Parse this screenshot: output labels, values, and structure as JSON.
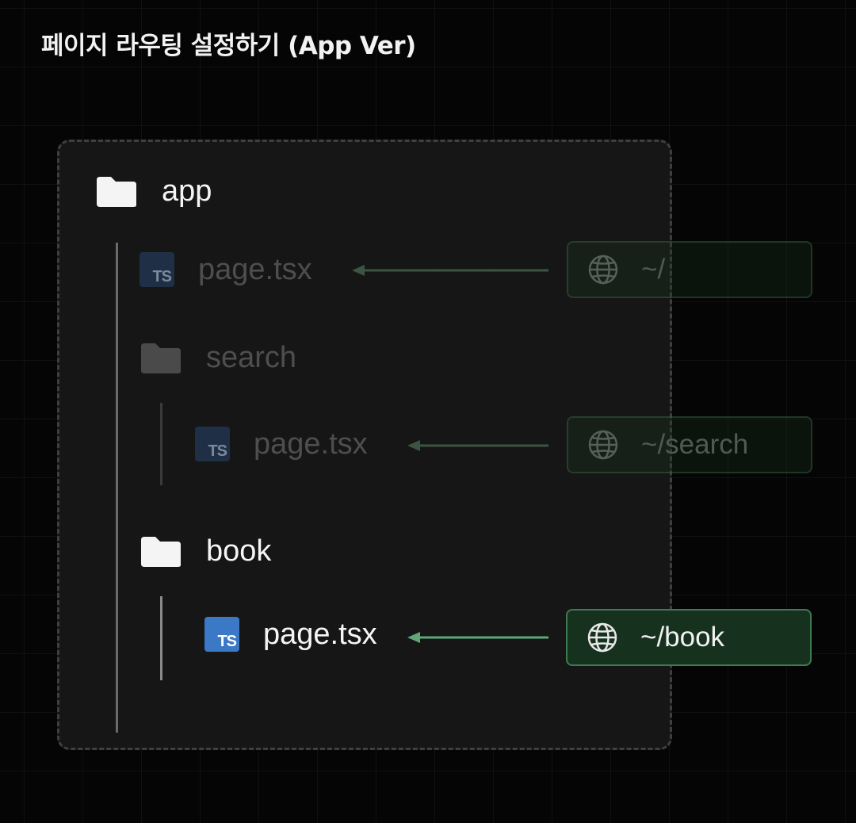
{
  "title": "페이지 라우팅 설정하기 (App Ver)",
  "tree": {
    "root": {
      "label": "app",
      "icon": "folder-icon"
    },
    "root_page": {
      "label": "page.tsx",
      "icon": "typescript-icon",
      "icon_text": "TS"
    },
    "search_folder": {
      "label": "search",
      "icon": "folder-icon"
    },
    "search_page": {
      "label": "page.tsx",
      "icon": "typescript-icon",
      "icon_text": "TS"
    },
    "book_folder": {
      "label": "book",
      "icon": "folder-icon"
    },
    "book_page": {
      "label": "page.tsx",
      "icon": "typescript-icon",
      "icon_text": "TS"
    }
  },
  "routes": {
    "root": {
      "path": "~/",
      "icon": "globe-icon"
    },
    "search": {
      "path": "~/search",
      "icon": "globe-icon"
    },
    "book": {
      "path": "~/book",
      "icon": "globe-icon"
    }
  },
  "colors": {
    "background": "#050505",
    "panel": "#181818",
    "accent_green": "#3e7a52",
    "ts_blue": "#3b78c6"
  }
}
